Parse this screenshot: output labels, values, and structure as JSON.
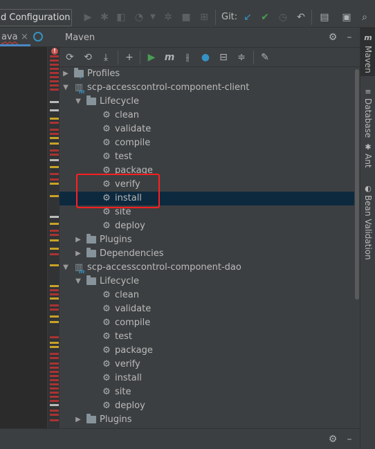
{
  "toolbar": {
    "run_config_label": "d Configuration...",
    "git_label": "Git:",
    "icons": [
      "play-icon",
      "debug-icon",
      "coverage-icon",
      "profile-icon",
      "dropdown-icon",
      "build-icon",
      "stop-icon",
      "git-update-icon",
      "git-commit-icon",
      "history-icon",
      "rollback-icon",
      "project-structure-icon",
      "run-anything-icon",
      "search-icon"
    ]
  },
  "editor": {
    "tab_label": "ava",
    "tab_close": "×",
    "error_badge": "!"
  },
  "maven": {
    "title": "Maven",
    "toolbar_icons": [
      "reload-icon",
      "generate-sources-icon",
      "download-icon",
      "add-icon",
      "run-icon",
      "maven-goal-icon",
      "toggle-offline-icon",
      "skip-tests-icon",
      "show-dependencies-icon",
      "collapse-all-icon",
      "settings-wrench-icon"
    ],
    "tree": [
      {
        "depth": 0,
        "expanded": false,
        "type": "profiles",
        "label": "Profiles"
      },
      {
        "depth": 0,
        "expanded": true,
        "type": "module",
        "label": "scp-accesscontrol-component-client"
      },
      {
        "depth": 1,
        "expanded": true,
        "type": "folder",
        "label": "Lifecycle"
      },
      {
        "depth": 2,
        "type": "goal",
        "label": "clean"
      },
      {
        "depth": 2,
        "type": "goal",
        "label": "validate"
      },
      {
        "depth": 2,
        "type": "goal",
        "label": "compile"
      },
      {
        "depth": 2,
        "type": "goal",
        "label": "test"
      },
      {
        "depth": 2,
        "type": "goal",
        "label": "package"
      },
      {
        "depth": 2,
        "type": "goal",
        "label": "verify"
      },
      {
        "depth": 2,
        "type": "goal",
        "label": "install",
        "selected": true
      },
      {
        "depth": 2,
        "type": "goal",
        "label": "site"
      },
      {
        "depth": 2,
        "type": "goal",
        "label": "deploy"
      },
      {
        "depth": 1,
        "expanded": false,
        "type": "folder",
        "label": "Plugins"
      },
      {
        "depth": 1,
        "expanded": false,
        "type": "folder",
        "label": "Dependencies"
      },
      {
        "depth": 0,
        "expanded": true,
        "type": "module",
        "label": "scp-accesscontrol-component-dao"
      },
      {
        "depth": 1,
        "expanded": true,
        "type": "folder",
        "label": "Lifecycle"
      },
      {
        "depth": 2,
        "type": "goal",
        "label": "clean"
      },
      {
        "depth": 2,
        "type": "goal",
        "label": "validate"
      },
      {
        "depth": 2,
        "type": "goal",
        "label": "compile"
      },
      {
        "depth": 2,
        "type": "goal",
        "label": "test"
      },
      {
        "depth": 2,
        "type": "goal",
        "label": "package"
      },
      {
        "depth": 2,
        "type": "goal",
        "label": "verify"
      },
      {
        "depth": 2,
        "type": "goal",
        "label": "install"
      },
      {
        "depth": 2,
        "type": "goal",
        "label": "site"
      },
      {
        "depth": 2,
        "type": "goal",
        "label": "deploy"
      },
      {
        "depth": 1,
        "expanded": false,
        "type": "folder",
        "label": "Plugins"
      }
    ]
  },
  "right_strip": {
    "tabs": [
      {
        "label": "Maven",
        "icon": "maven-icon",
        "active": true
      },
      {
        "label": "Database",
        "icon": "database-icon",
        "active": false
      },
      {
        "label": "Ant",
        "icon": "ant-icon",
        "active": false
      },
      {
        "label": "Bean Validation",
        "icon": "bean-validation-icon",
        "active": false
      }
    ]
  },
  "colors": {
    "accent": "#4a88c7",
    "selection": "#0d293e",
    "highlight_box": "#ff1f1f",
    "run_green": "#499c54",
    "vcs_blue": "#3592c4"
  }
}
